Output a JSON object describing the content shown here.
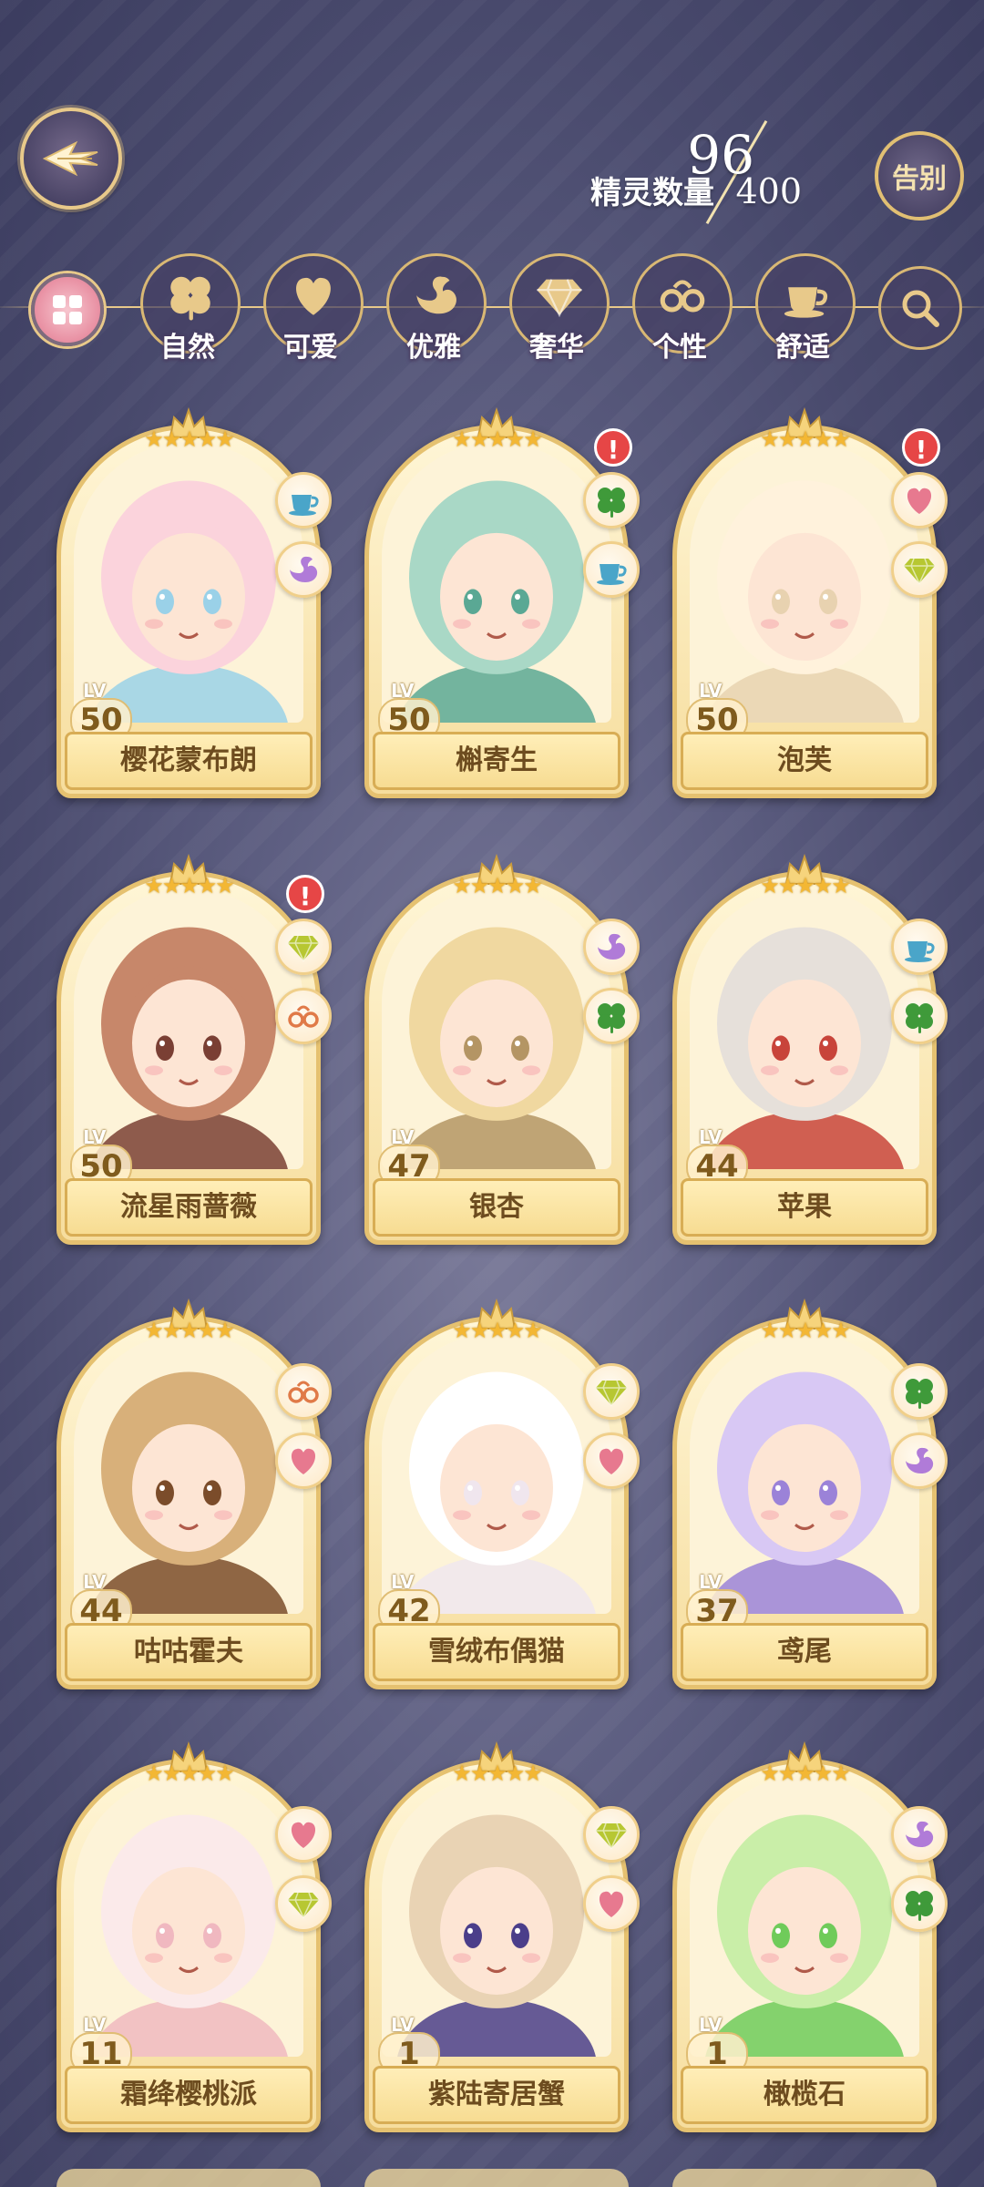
{
  "header": {
    "spirit_count": "96",
    "spirit_max": "400",
    "spirit_label": "精灵数量",
    "farewell_label": "告别"
  },
  "filters": [
    {
      "label": "自然",
      "icon": "clover-icon"
    },
    {
      "label": "可爱",
      "icon": "heart-icon"
    },
    {
      "label": "优雅",
      "icon": "swan-icon"
    },
    {
      "label": "奢华",
      "icon": "diamond-icon"
    },
    {
      "label": "个性",
      "icon": "glasses-icon"
    },
    {
      "label": "舒适",
      "icon": "teacup-icon"
    }
  ],
  "level_label": "LV",
  "star_glyphs": "★★★★★",
  "alert_glyph": "!",
  "cards": [
    {
      "name": "樱花蒙布朗",
      "level": "50",
      "stars": 5,
      "alert": false,
      "tags": [
        "teacup-icon",
        "swan-icon"
      ],
      "palette": [
        "#fbd3dc",
        "#9ad1e8"
      ]
    },
    {
      "name": "槲寄生",
      "level": "50",
      "stars": 5,
      "alert": true,
      "tags": [
        "clover-icon",
        "teacup-icon"
      ],
      "palette": [
        "#a9d8c6",
        "#5aa894"
      ]
    },
    {
      "name": "泡芙",
      "level": "50",
      "stars": 5,
      "alert": true,
      "tags": [
        "heart-icon",
        "diamond-icon"
      ],
      "palette": [
        "#fff2dc",
        "#e8d2b0"
      ]
    },
    {
      "name": "流星雨蔷薇",
      "level": "50",
      "stars": 5,
      "alert": true,
      "tags": [
        "diamond-icon",
        "glasses-icon"
      ],
      "palette": [
        "#c7876a",
        "#7a3f34"
      ]
    },
    {
      "name": "银杏",
      "level": "47",
      "stars": 5,
      "alert": false,
      "tags": [
        "swan-icon",
        "clover-icon"
      ],
      "palette": [
        "#f0d8a0",
        "#b49564"
      ]
    },
    {
      "name": "苹果",
      "level": "44",
      "stars": 5,
      "alert": false,
      "tags": [
        "teacup-icon",
        "clover-icon"
      ],
      "palette": [
        "#e6e0da",
        "#c8443a"
      ]
    },
    {
      "name": "咕咕霍夫",
      "level": "44",
      "stars": 5,
      "alert": false,
      "tags": [
        "glasses-icon",
        "heart-icon"
      ],
      "palette": [
        "#d8b07a",
        "#7b4c2a"
      ]
    },
    {
      "name": "雪绒布偶猫",
      "level": "42",
      "stars": 5,
      "alert": false,
      "tags": [
        "diamond-icon",
        "heart-icon"
      ],
      "palette": [
        "#ffffff",
        "#f0e6ee"
      ]
    },
    {
      "name": "鸢尾",
      "level": "37",
      "stars": 5,
      "alert": false,
      "tags": [
        "clover-icon",
        "swan-icon"
      ],
      "palette": [
        "#d8c8f4",
        "#9b82d8"
      ]
    },
    {
      "name": "霜绛樱桃派",
      "level": "11",
      "stars": 5,
      "alert": false,
      "tags": [
        "heart-icon",
        "diamond-icon"
      ],
      "palette": [
        "#fbeaea",
        "#f0b8c0"
      ]
    },
    {
      "name": "紫陆寄居蟹",
      "level": "1",
      "stars": 5,
      "alert": false,
      "tags": [
        "diamond-icon",
        "heart-icon"
      ],
      "palette": [
        "#e9d3b4",
        "#4b3e8a"
      ]
    },
    {
      "name": "橄榄石",
      "level": "1",
      "stars": 5,
      "alert": false,
      "tags": [
        "swan-icon",
        "clover-icon"
      ],
      "palette": [
        "#c9eea8",
        "#6fcb5a"
      ]
    }
  ]
}
